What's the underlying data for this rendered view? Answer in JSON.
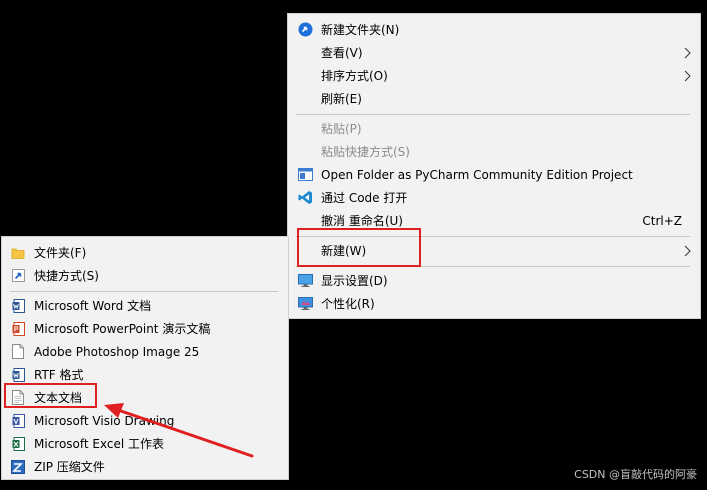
{
  "context_menu": {
    "items": [
      {
        "label": "新建文件夹(N)",
        "icon": "new-folder-icon"
      },
      {
        "label": "查看(V)",
        "has_submenu": true
      },
      {
        "label": "排序方式(O)",
        "has_submenu": true
      },
      {
        "label": "刷新(E)"
      },
      {
        "label": "粘贴(P)",
        "disabled": true
      },
      {
        "label": "粘贴快捷方式(S)",
        "disabled": true
      },
      {
        "label": "Open Folder as PyCharm Community Edition Project",
        "icon": "pycharm-icon"
      },
      {
        "label": "通过 Code 打开",
        "icon": "vscode-icon"
      },
      {
        "label": "撤消 重命名(U)",
        "shortcut": "Ctrl+Z"
      },
      {
        "label": "新建(W)",
        "has_submenu": true
      },
      {
        "label": "显示设置(D)",
        "icon": "display-settings-icon"
      },
      {
        "label": "个性化(R)",
        "icon": "personalize-icon"
      }
    ]
  },
  "new_submenu": {
    "items": [
      {
        "label": "文件夹(F)",
        "icon": "folder-icon"
      },
      {
        "label": "快捷方式(S)",
        "icon": "shortcut-icon"
      },
      {
        "label": "Microsoft Word 文档",
        "icon": "word-icon"
      },
      {
        "label": "Microsoft PowerPoint 演示文稿",
        "icon": "powerpoint-icon"
      },
      {
        "label": "Adobe Photoshop Image 25",
        "icon": "document-icon"
      },
      {
        "label": "RTF 格式",
        "icon": "rtf-icon"
      },
      {
        "label": "文本文档",
        "icon": "text-document-icon"
      },
      {
        "label": "Microsoft Visio Drawing",
        "icon": "visio-icon"
      },
      {
        "label": "Microsoft Excel 工作表",
        "icon": "excel-icon"
      },
      {
        "label": "ZIP 压缩文件",
        "icon": "zip-icon"
      }
    ]
  },
  "annotation_color": "#e02020",
  "watermark": "CSDN @盲敲代码的阿豪"
}
